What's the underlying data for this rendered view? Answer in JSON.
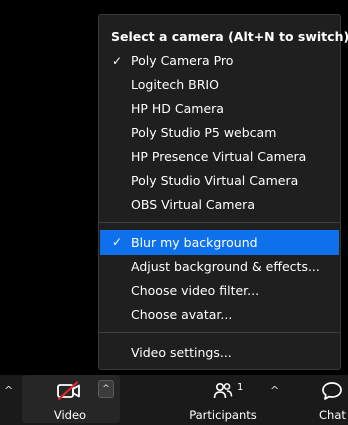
{
  "camera_menu": {
    "title": "Select a camera (Alt+N to switch)",
    "cameras": [
      {
        "label": "Poly Camera Pro",
        "checked": true
      },
      {
        "label": "Logitech BRIO",
        "checked": false
      },
      {
        "label": "HP HD Camera",
        "checked": false
      },
      {
        "label": "Poly Studio P5 webcam",
        "checked": false
      },
      {
        "label": "HP Presence Virtual Camera",
        "checked": false
      },
      {
        "label": "Poly Studio Virtual Camera",
        "checked": false
      },
      {
        "label": "OBS Virtual Camera",
        "checked": false
      }
    ],
    "effects": [
      {
        "label": "Blur my background",
        "checked": true,
        "highlighted": true
      },
      {
        "label": "Adjust background & effects...",
        "checked": false
      },
      {
        "label": "Choose video filter...",
        "checked": false
      },
      {
        "label": "Choose avatar...",
        "checked": false
      }
    ],
    "settings_label": "Video settings...",
    "check_glyph": "✓",
    "highlight_color": "#0e71eb"
  },
  "toolbar": {
    "video_label": "Video",
    "video_icon": "video-off-icon",
    "participants_label": "Participants",
    "participants_count": "1",
    "participants_icon": "participants-icon",
    "chat_label": "Chat",
    "chat_icon": "chat-icon",
    "caret_glyph": "^",
    "mute_color": "#e02828"
  }
}
